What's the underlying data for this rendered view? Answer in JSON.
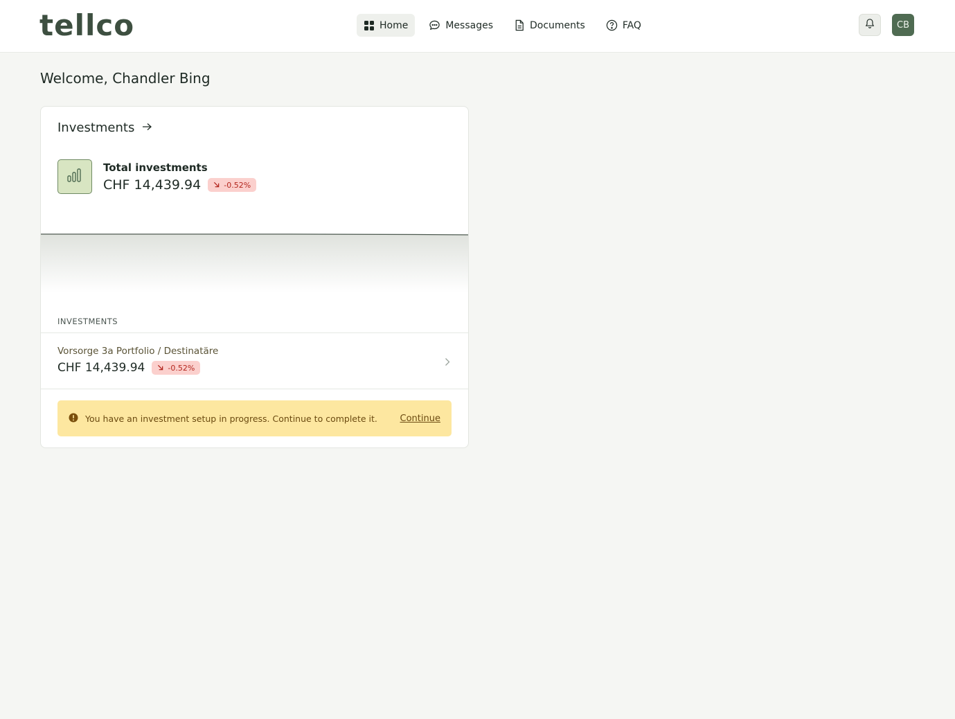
{
  "brand": {
    "logo_text": "tellco",
    "accent": "#4f6b52"
  },
  "nav": {
    "items": [
      {
        "label": "Home",
        "icon": "grid-icon",
        "active": true
      },
      {
        "label": "Messages",
        "icon": "chat-bubble-icon",
        "active": false
      },
      {
        "label": "Documents",
        "icon": "document-icon",
        "active": false
      },
      {
        "label": "FAQ",
        "icon": "question-circle-icon",
        "active": false
      }
    ]
  },
  "header": {
    "notifications_icon": "bell-icon",
    "avatar_initials": "CB"
  },
  "welcome": "Welcome, Chandler Bing",
  "investments_card": {
    "title": "Investments",
    "title_icon": "arrow-right-icon",
    "summary": {
      "label": "Total investments",
      "value": "CHF 14,439.94",
      "change": "-0.52%",
      "change_icon": "arrow-down-right-icon",
      "icon": "bar-chart-icon"
    },
    "section_label": "INVESTMENTS",
    "items": [
      {
        "name": "Vorsorge 3a Portfolio / Destinatäre",
        "value": "CHF 14,439.94",
        "change": "-0.52%"
      }
    ],
    "alert": {
      "icon": "alert-circle-icon",
      "text": "You have an investment setup in progress. Continue to complete it.",
      "link": "Continue"
    }
  },
  "colors": {
    "negative_badge_bg": "#fbd0cd",
    "negative_badge_text": "#b3261e",
    "alert_bg": "#fde7a0"
  }
}
